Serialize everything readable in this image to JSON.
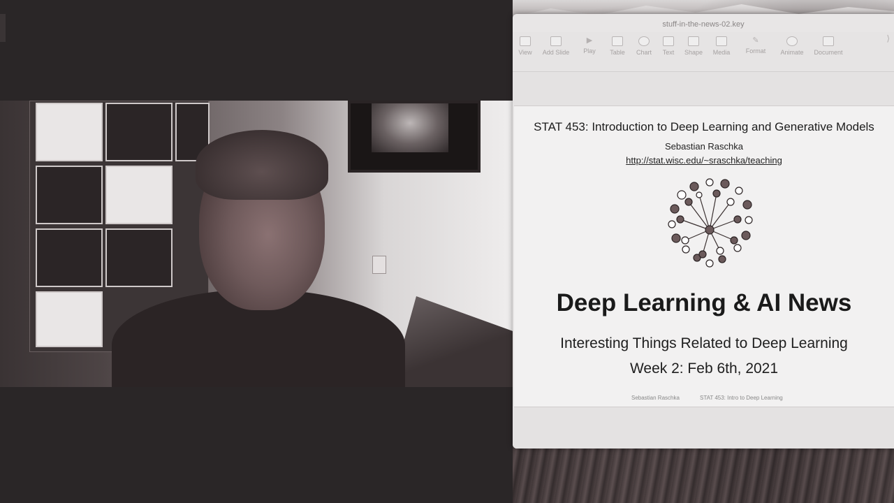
{
  "keynote": {
    "window_title": "stuff-in-the-news-02.key",
    "toolbar": [
      {
        "label": "View",
        "icon": "sidebar-view-icon"
      },
      {
        "label": "Add Slide",
        "icon": "add-slide-icon"
      },
      {
        "label": "Play",
        "icon": "play-icon"
      },
      {
        "label": "Table",
        "icon": "table-icon"
      },
      {
        "label": "Chart",
        "icon": "chart-icon"
      },
      {
        "label": "Text",
        "icon": "text-icon"
      },
      {
        "label": "Shape",
        "icon": "shape-icon"
      },
      {
        "label": "Media",
        "icon": "media-icon"
      },
      {
        "label": "Format",
        "icon": "format-brush-icon"
      },
      {
        "label": "Animate",
        "icon": "animate-icon"
      },
      {
        "label": "Document",
        "icon": "document-icon"
      }
    ],
    "slide": {
      "course": "STAT 453: Introduction to Deep Learning and Generative Models",
      "author": "Sebastian Raschka",
      "url": "http://stat.wisc.edu/~sraschka/teaching",
      "headline": "Deep Learning & AI News",
      "subtitle": "Interesting Things Related to Deep Learning",
      "week": "Week 2: Feb 6th, 2021",
      "footer_left": "Sebastian Raschka",
      "footer_right": "STAT 453: Intro to Deep Learning"
    }
  },
  "colors": {
    "video_background": "#2a2627",
    "slide_background": "#f2f1f1",
    "toolbar_background": "#e6e4e4"
  }
}
